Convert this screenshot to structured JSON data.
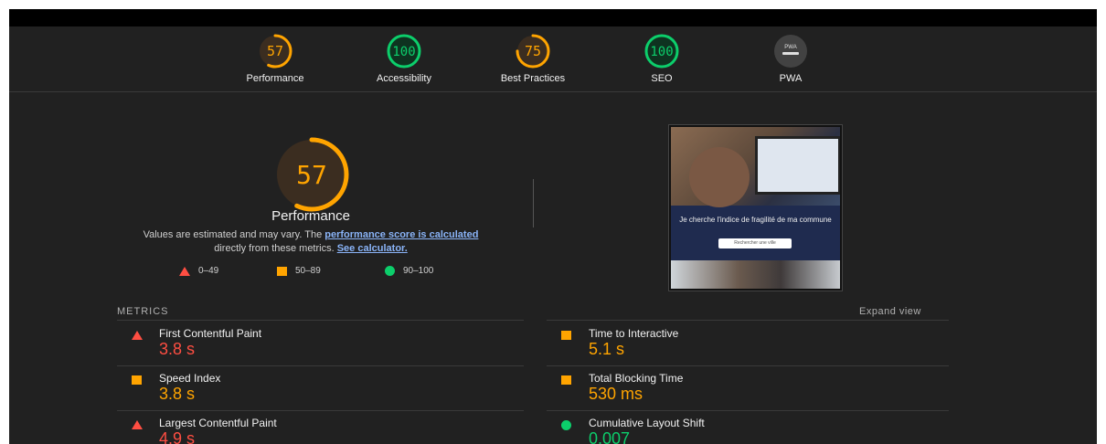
{
  "categories": [
    {
      "score": "57",
      "label": "Performance",
      "value": 0.57,
      "color": "#ffa400"
    },
    {
      "score": "100",
      "label": "Accessibility",
      "value": 1.0,
      "color": "#0cce6b"
    },
    {
      "score": "75",
      "label": "Best Practices",
      "value": 0.75,
      "color": "#ffa400"
    },
    {
      "score": "100",
      "label": "SEO",
      "value": 1.0,
      "color": "#0cce6b"
    },
    {
      "badge": "PWA",
      "label": "PWA",
      "color": "#9e9e9e"
    }
  ],
  "performance": {
    "score": "57",
    "value": 0.57,
    "title": "Performance",
    "desc_prefix": "Values are estimated and may vary. The ",
    "desc_link": "performance score is calculated",
    "desc_middle": " directly from these metrics. ",
    "desc_link2": "See calculator."
  },
  "legend": {
    "range_fail": "0–49",
    "range_average": "50–89",
    "range_pass": "90–100"
  },
  "screenshot": {
    "caption": "Je cherche l'indice de fragilité de ma commune",
    "button": "Rechercher une ville"
  },
  "metrics": {
    "section_label": "METRICS",
    "expand_label": "Expand view",
    "items": [
      {
        "name": "First Contentful Paint",
        "value": "3.8 s",
        "status": "fail"
      },
      {
        "name": "Time to Interactive",
        "value": "5.1 s",
        "status": "average"
      },
      {
        "name": "Speed Index",
        "value": "3.8 s",
        "status": "average"
      },
      {
        "name": "Total Blocking Time",
        "value": "530 ms",
        "status": "average"
      },
      {
        "name": "Largest Contentful Paint",
        "value": "4.9 s",
        "status": "fail"
      },
      {
        "name": "Cumulative Layout Shift",
        "value": "0.007",
        "status": "pass"
      }
    ]
  },
  "colors": {
    "fail": "#ff4e42",
    "average": "#ffa400",
    "pass": "#0cce6b",
    "background": "#212121"
  }
}
